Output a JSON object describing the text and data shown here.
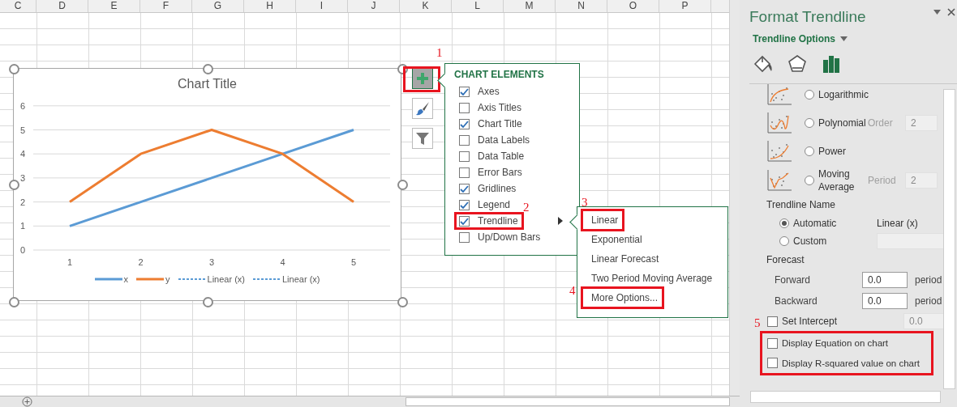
{
  "sheet": {
    "columns": [
      "C",
      "D",
      "E",
      "F",
      "G",
      "H",
      "I",
      "J",
      "K",
      "L",
      "M",
      "N",
      "O",
      "P"
    ]
  },
  "chart": {
    "selected": true,
    "chart_data": {
      "type": "line",
      "title": "Chart Title",
      "categories": [
        "1",
        "2",
        "3",
        "4",
        "5"
      ],
      "ylim": [
        0,
        6
      ],
      "yticks": [
        0,
        1,
        2,
        3,
        4,
        5,
        6
      ],
      "grid": true,
      "series": [
        {
          "name": "x",
          "color": "#5b9bd5",
          "values": [
            1,
            2,
            3,
            4,
            5
          ]
        },
        {
          "name": "y",
          "color": "#ed7d31",
          "values": [
            2,
            4,
            5,
            4,
            2
          ]
        }
      ]
    },
    "trend_legend": [
      {
        "label": "Linear (x)",
        "color": "#5b9bd5"
      },
      {
        "label": "Linear (x)",
        "color": "#5b9bd5"
      }
    ]
  },
  "chart_buttons": [
    {
      "kind": "add",
      "selected": true,
      "callout": "1"
    },
    {
      "kind": "style",
      "selected": false
    },
    {
      "kind": "filter",
      "selected": false
    }
  ],
  "chart_elements": {
    "title": "CHART ELEMENTS",
    "items": [
      {
        "label": "Axes",
        "checked": true
      },
      {
        "label": "Axis Titles",
        "checked": false
      },
      {
        "label": "Chart Title",
        "checked": true
      },
      {
        "label": "Data Labels",
        "checked": false
      },
      {
        "label": "Data Table",
        "checked": false
      },
      {
        "label": "Error Bars",
        "checked": false
      },
      {
        "label": "Gridlines",
        "checked": true
      },
      {
        "label": "Legend",
        "checked": true
      },
      {
        "label": "Trendline",
        "checked": true,
        "callout": "2",
        "submenu": true
      },
      {
        "label": "Up/Down Bars",
        "checked": false
      }
    ]
  },
  "trendline_menu": {
    "items": [
      {
        "label": "Linear",
        "callout": "3"
      },
      {
        "label": "Exponential"
      },
      {
        "label": "Linear Forecast"
      },
      {
        "label": "Two Period Moving Average"
      },
      {
        "label": "More Options...",
        "callout": "4"
      }
    ]
  },
  "pane": {
    "title": "Format Trendline",
    "section": "Trendline Options",
    "tabs": [
      {
        "kind": "fill",
        "selected": false
      },
      {
        "kind": "effects",
        "selected": false
      },
      {
        "kind": "options",
        "selected": true
      }
    ],
    "types": [
      {
        "kind": "logarithmic",
        "label": "Logarithmic",
        "selected": false
      },
      {
        "kind": "polynomial",
        "label": "Polynomial",
        "selected": false,
        "param_label": "Order",
        "param_value": "2",
        "param_disabled": true
      },
      {
        "kind": "power",
        "label": "Power",
        "selected": false
      },
      {
        "kind": "moving",
        "label": "Moving Average",
        "selected": false,
        "param_label": "Period",
        "param_value": "2",
        "param_disabled": true
      }
    ],
    "name_heading": "Trendline Name",
    "name_options": [
      {
        "label": "Automatic",
        "selected": true,
        "value": "Linear (x)"
      },
      {
        "label": "Custom",
        "selected": false
      }
    ],
    "forecast_heading": "Forecast",
    "forecast": [
      {
        "label": "Forward",
        "value": "0.0",
        "unit": "period"
      },
      {
        "label": "Backward",
        "value": "0.0",
        "unit": "period"
      }
    ],
    "intercept": {
      "label": "Set Intercept",
      "checked": false,
      "value": "0.0",
      "disabled": true
    },
    "display_callout": "5",
    "display": [
      {
        "label": "Display Equation on chart",
        "checked": false
      },
      {
        "label": "Display R-squared value on chart",
        "checked": false
      }
    ]
  }
}
